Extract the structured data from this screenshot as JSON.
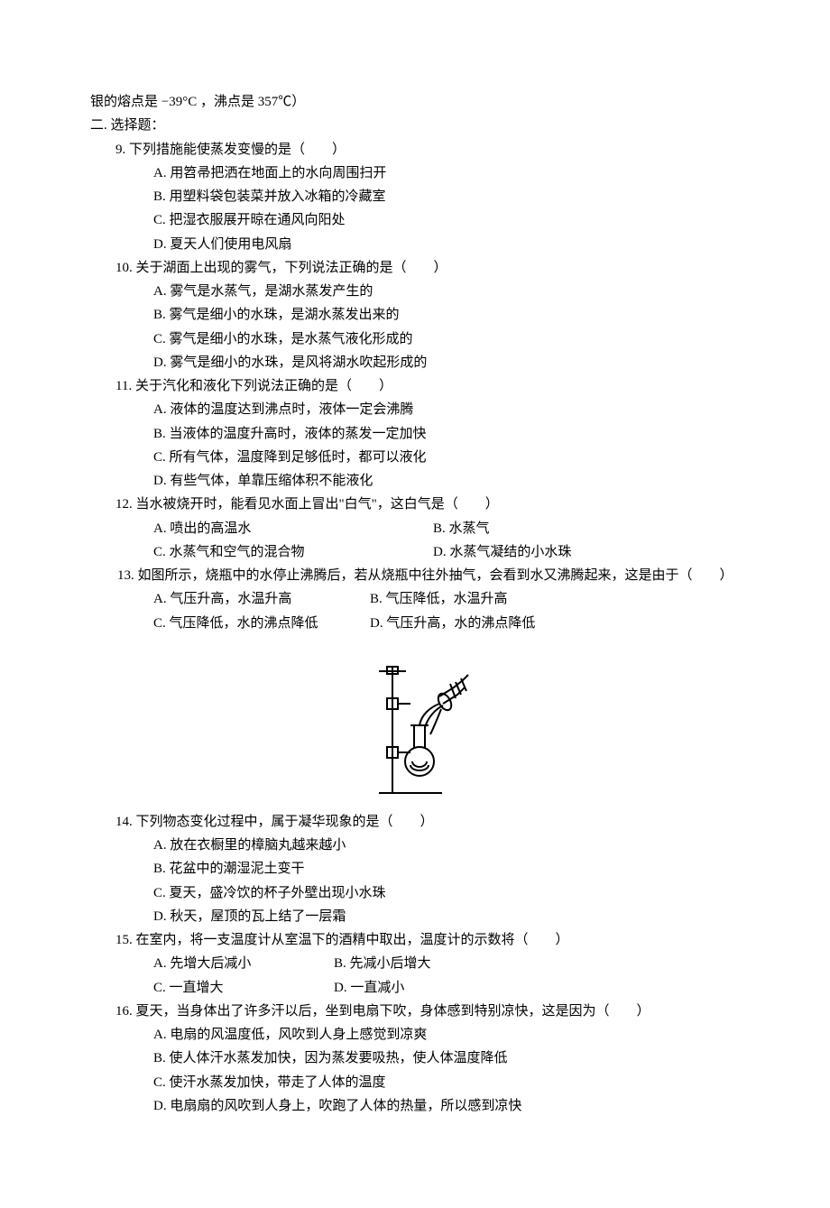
{
  "intro": "银的熔点是 −39°C ，沸点是 357℃）",
  "section_title": "二. 选择题：",
  "q9": {
    "stem": "9. 下列措施能使蒸发变慢的是（　　）",
    "A": "A. 用笤帚把洒在地面上的水向周围扫开",
    "B": "B. 用塑料袋包装菜并放入冰箱的冷藏室",
    "C": "C. 把湿衣服展开晾在通风向阳处",
    "D": "D. 夏天人们使用电风扇"
  },
  "q10": {
    "stem": "10. 关于湖面上出现的雾气，下列说法正确的是（　　）",
    "A": "A. 雾气是水蒸气，是湖水蒸发产生的",
    "B": "B. 雾气是细小的水珠，是湖水蒸发出来的",
    "C": "C. 雾气是细小的水珠，是水蒸气液化形成的",
    "D": "D. 雾气是细小的水珠，是风将湖水吹起形成的"
  },
  "q11": {
    "stem": "11. 关于汽化和液化下列说法正确的是（　　）",
    "A": "A. 液体的温度达到沸点时，液体一定会沸腾",
    "B": "B. 当液体的温度升高时，液体的蒸发一定加快",
    "C": "C. 所有气体，温度降到足够低时，都可以液化",
    "D": "D. 有些气体，单靠压缩体积不能液化"
  },
  "q12": {
    "stem": "12. 当水被烧开时，能看见水面上冒出\"白气\"，这白气是（　　）",
    "A": "A. 喷出的高温水",
    "B": "B. 水蒸气",
    "C": "C. 水蒸气和空气的混合物",
    "D": "D. 水蒸气凝结的小水珠"
  },
  "q13": {
    "stem": "　　13. 如图所示，烧瓶中的水停止沸腾后，若从烧瓶中往外抽气，会看到水又沸腾起来，这是由于（　　）",
    "A": "A. 气压升高，水温升高",
    "B": "B. 气压降低，水温升高",
    "C": "C. 气压降低，水的沸点降低",
    "D": "D. 气压升高，水的沸点降低"
  },
  "q14": {
    "stem": "14. 下列物态变化过程中，属于凝华现象的是（　　）",
    "A": "A. 放在衣橱里的樟脑丸越来越小",
    "B": "B. 花盆中的潮湿泥土变干",
    "C": "C. 夏天，盛冷饮的杯子外壁出现小水珠",
    "D": "D. 秋天，屋顶的瓦上结了一层霜"
  },
  "q15": {
    "stem": "15. 在室内，将一支温度计从室温下的酒精中取出，温度计的示数将（　　）",
    "A": "A. 先增大后减小",
    "B": "B. 先减小后增大",
    "C": "C. 一直增大",
    "D": "D. 一直减小"
  },
  "q16": {
    "stem": "16. 夏天，当身体出了许多汗以后，坐到电扇下吹，身体感到特别凉快，这是因为（　　）",
    "A": "A. 电扇的风温度低，风吹到人身上感觉到凉爽",
    "B": "B. 使人体汗水蒸发加快，因为蒸发要吸热，使人体温度降低",
    "C": "C. 使汗水蒸发加快，带走了人体的温度",
    "D": "D. 电扇扇的风吹到人身上，吹跑了人体的热量，所以感到凉快"
  }
}
